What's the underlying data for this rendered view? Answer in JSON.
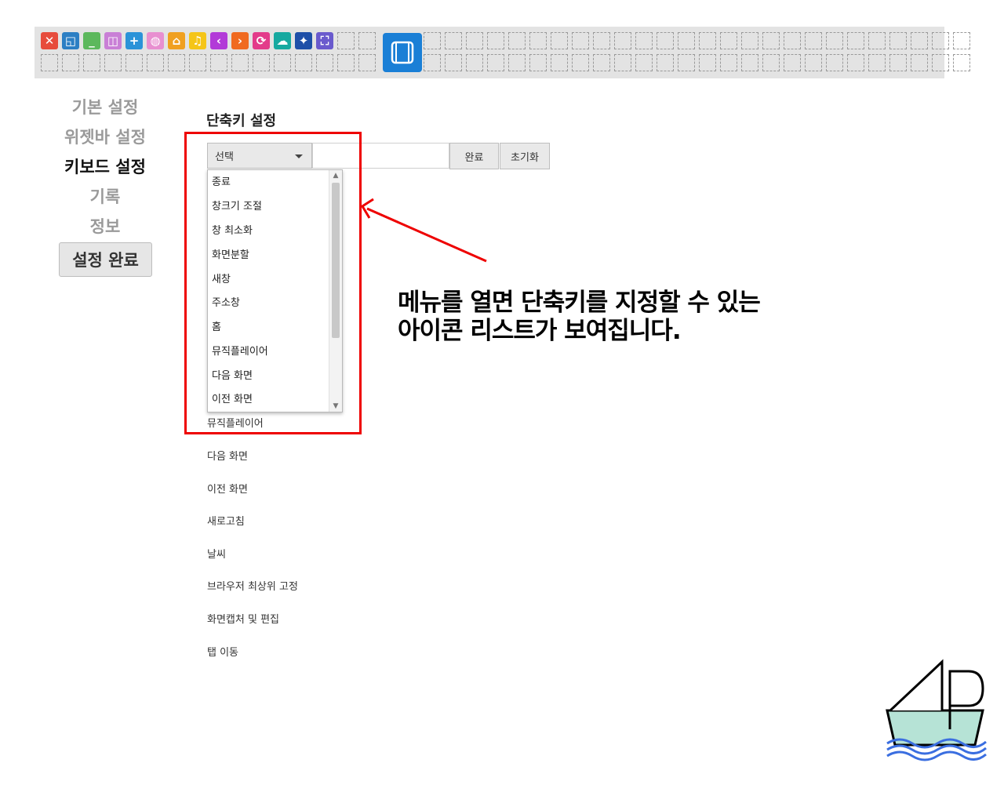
{
  "widget_bar": {
    "icons": [
      {
        "name": "close-icon",
        "color": "#e74c3c",
        "glyph": "✕"
      },
      {
        "name": "resize-icon",
        "color": "#2c7fc4",
        "glyph": "◱"
      },
      {
        "name": "minimize-icon",
        "color": "#5cb85c",
        "glyph": "_"
      },
      {
        "name": "split-screen-icon",
        "color": "#c97fd6",
        "glyph": "◫"
      },
      {
        "name": "new-window-icon",
        "color": "#2b93d8",
        "glyph": "+"
      },
      {
        "name": "address-bar-icon",
        "color": "#e88fd0",
        "glyph": "◍"
      },
      {
        "name": "home-icon",
        "color": "#f0a020",
        "glyph": "⌂"
      },
      {
        "name": "music-player-icon",
        "color": "#f5c518",
        "glyph": "♫"
      },
      {
        "name": "previous-icon",
        "color": "#b23ad8",
        "glyph": "‹"
      },
      {
        "name": "next-icon",
        "color": "#f06a20",
        "glyph": "›"
      },
      {
        "name": "refresh-icon",
        "color": "#e33b8a",
        "glyph": "⟳"
      },
      {
        "name": "weather-icon",
        "color": "#16a9a0",
        "glyph": "☁"
      },
      {
        "name": "pin-top-icon",
        "color": "#1e4fa8",
        "glyph": "✦"
      },
      {
        "name": "screen-capture-icon",
        "color": "#6a5acd",
        "glyph": "⛶"
      }
    ]
  },
  "nav": {
    "items": [
      {
        "label": "기본 설정",
        "active": false
      },
      {
        "label": "위젯바 설정",
        "active": false
      },
      {
        "label": "키보드 설정",
        "active": true
      },
      {
        "label": "기록",
        "active": false
      },
      {
        "label": "정보",
        "active": false
      }
    ],
    "done_label": "설정 완료"
  },
  "shortcut": {
    "title": "단축키 설정",
    "select_value": "선택",
    "input_value": "",
    "confirm_label": "완료",
    "reset_label": "초기화"
  },
  "dropdown": {
    "options": [
      "종료",
      "창크기 조절",
      "창 최소화",
      "화면분할",
      "새창",
      "주소창",
      "홈",
      "뮤직플레이어",
      "다음 화면",
      "이전 화면"
    ]
  },
  "background_list": {
    "items": [
      "뮤직플레이어",
      "다음 화면",
      "이전 화면",
      "새로고침",
      "날씨",
      "브라우저 최상위 고정",
      "화면캡처 및 편집",
      "탭 이동"
    ]
  },
  "annotation": {
    "line1": "메뉴를 열면 단축키를 지정할 수 있는",
    "line2": "아이콘 리스트가 보여집니다."
  }
}
